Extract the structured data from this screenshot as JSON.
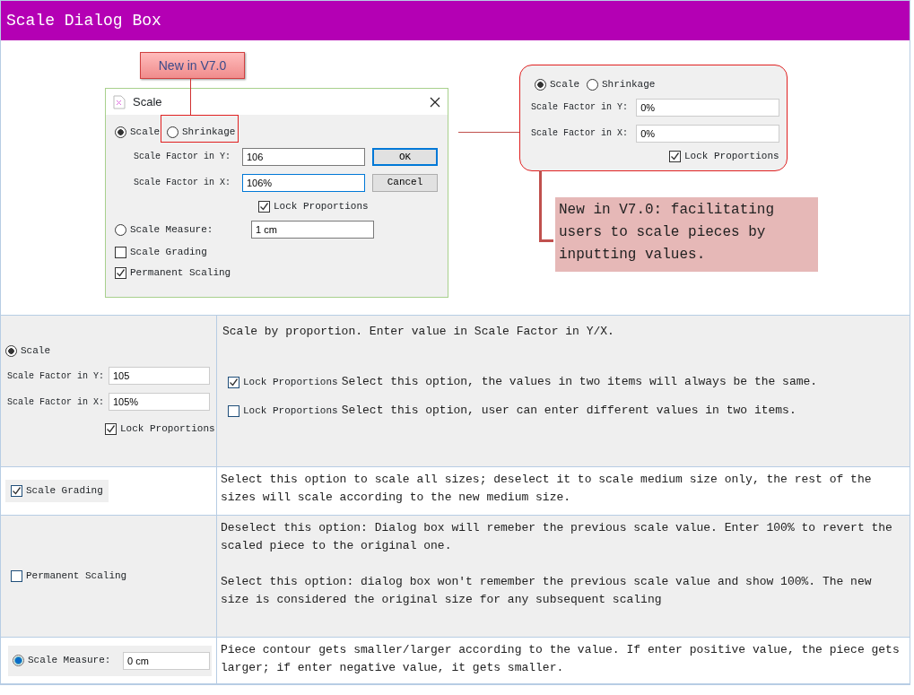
{
  "header": {
    "title": "Scale Dialog Box"
  },
  "figure": {
    "callout": "New in V7.0",
    "dialog": {
      "title": "Scale",
      "modes": [
        {
          "label": "Scale",
          "selected": true
        },
        {
          "label": "Shrinkage",
          "selected": false
        }
      ],
      "fields": [
        {
          "label": "Scale Factor in Y:",
          "value": "106"
        },
        {
          "label": "Scale Factor in X:",
          "value": "106%"
        }
      ],
      "buttons": [
        "OK",
        "Cancel"
      ],
      "lock": {
        "label": "Lock Proportions",
        "checked": true
      },
      "measure": {
        "label": "Scale Measure:",
        "selected": false,
        "value": "1 cm"
      },
      "options": [
        {
          "label": "Scale Grading",
          "checked": false
        },
        {
          "label": "Permanent Scaling",
          "checked": true
        }
      ]
    },
    "panel": {
      "modes": [
        {
          "label": "Scale",
          "selected": true
        },
        {
          "label": "Shrinkage",
          "selected": false
        }
      ],
      "fields": [
        {
          "label": "Scale Factor in Y:",
          "value": "0%"
        },
        {
          "label": "Scale Factor in X:",
          "value": "0%"
        }
      ],
      "lock": {
        "label": "Lock Proportions",
        "checked": true
      }
    },
    "note": "New in V7.0: facilitating users to scale pieces by inputting values."
  },
  "rows": [
    {
      "kind": "scale",
      "mode": {
        "label": "Scale",
        "selected": true
      },
      "fields": [
        {
          "label": "Scale Factor in Y:",
          "value": "105"
        },
        {
          "label": "Scale Factor in X:",
          "value": "105%"
        }
      ],
      "lock": {
        "label": "Lock Proportions",
        "checked": true
      },
      "notes": [
        {
          "text": "Scale by proportion.  Enter value in Scale Factor in Y/X."
        },
        {
          "checkbox": {
            "label": "Lock Proportions",
            "checked": true
          },
          "text": "Select this option, the values in two items will always be the same."
        },
        {
          "checkbox": {
            "label": "Lock Proportions",
            "checked": false
          },
          "text": "Select this option, user can enter different values in two items."
        }
      ]
    },
    {
      "kind": "checkbox",
      "option": {
        "label": "Scale Grading",
        "checked": true
      },
      "notes": [
        {
          "text": "Select this option to scale all sizes; deselect it to scale medium size only, the rest of the sizes will scale according to the new medium size."
        }
      ]
    },
    {
      "kind": "checkbox",
      "option": {
        "label": "Permanent Scaling",
        "checked": false
      },
      "notes": [
        {
          "text": "Deselect this option: Dialog box will remeber the previous scale value. Enter 100% to revert the scaled piece to the original one."
        },
        {
          "text": "Select this option: dialog box won't remember the previous scale value and show 100%. The new size is considered the original size for any subsequent scaling"
        }
      ]
    },
    {
      "kind": "measure",
      "measure": {
        "label": "Scale Measure:",
        "selected": true,
        "value": "0 cm"
      },
      "notes": [
        {
          "text": "Piece contour gets smaller/larger according to the value. If enter positive value, the piece gets larger; if enter negative value, it gets smaller."
        }
      ]
    }
  ]
}
